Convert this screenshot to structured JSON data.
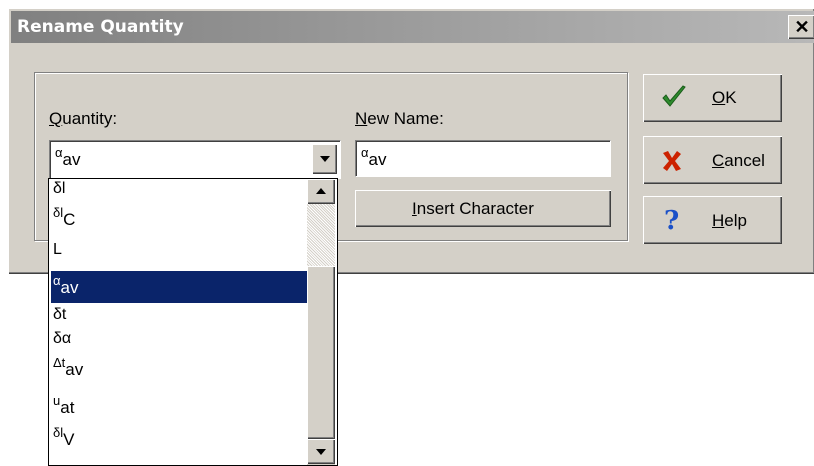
{
  "dialog": {
    "title": "Rename Quantity",
    "close_label": "✕"
  },
  "quantity": {
    "label_accel": "Q",
    "label_rest": "uantity:",
    "selected": {
      "base": "α",
      "sub": "av"
    }
  },
  "new_name": {
    "label_accel": "N",
    "label_rest": "ew Name:",
    "value": {
      "base": "α",
      "sub": "av"
    }
  },
  "insert_character": {
    "accel": "I",
    "rest": "nsert Character"
  },
  "buttons": {
    "ok": {
      "accel": "O",
      "rest": "K",
      "icon": "check-icon",
      "color": "#2e8b2e"
    },
    "cancel": {
      "accel": "C",
      "rest": "ancel",
      "icon": "x-icon",
      "color": "#cc2200"
    },
    "help": {
      "accel": "H",
      "rest": "elp",
      "icon": "question-icon",
      "color": "#1a50c8"
    }
  },
  "list_items": [
    {
      "base": "δl",
      "sub": ""
    },
    {
      "base": "δl",
      "sub": "C"
    },
    {
      "base": "L",
      "sub": ""
    },
    {
      "base": "α",
      "sub": "av",
      "selected": true
    },
    {
      "base": "δt",
      "sub": ""
    },
    {
      "base": "δα",
      "sub": ""
    },
    {
      "base": "Δt",
      "sub": "av"
    },
    {
      "base": "u",
      "sub": "at"
    },
    {
      "base": "δl",
      "sub": "V"
    }
  ],
  "colors": {
    "selection": "#0a246a",
    "face": "#d4d0c8"
  }
}
